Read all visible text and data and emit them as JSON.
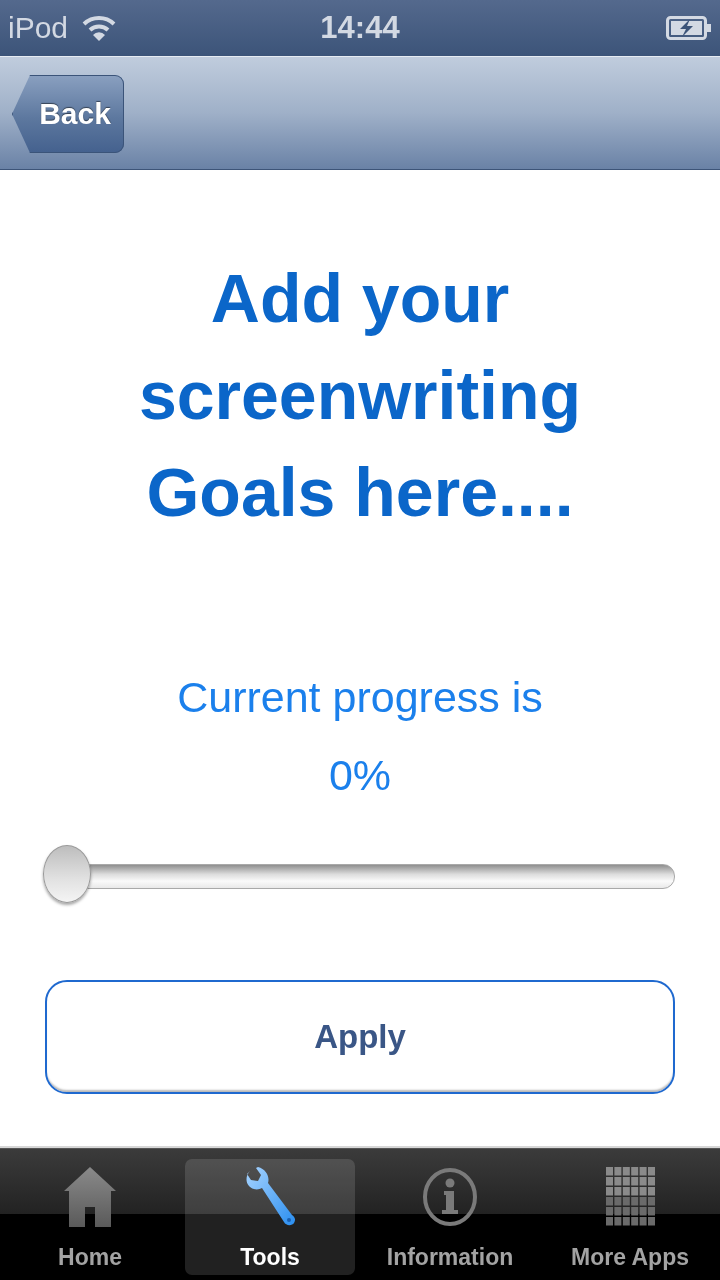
{
  "status_bar": {
    "carrier": "iPod",
    "time": "14:44"
  },
  "nav_bar": {
    "back_button": "Back"
  },
  "title": "Add your screenwriting Goals here....",
  "progress": {
    "label": "Current progress is",
    "reading": "0%"
  },
  "slider": {
    "level": 0
  },
  "apply_button": "Apply",
  "tab_bar": [
    {
      "label": "Home",
      "kind": "home",
      "selected": false
    },
    {
      "label": "Tools",
      "kind": "tools",
      "selected": true
    },
    {
      "label": "Information",
      "kind": "info",
      "selected": false
    },
    {
      "label": "More Apps",
      "kind": "grid",
      "selected": false
    }
  ]
}
